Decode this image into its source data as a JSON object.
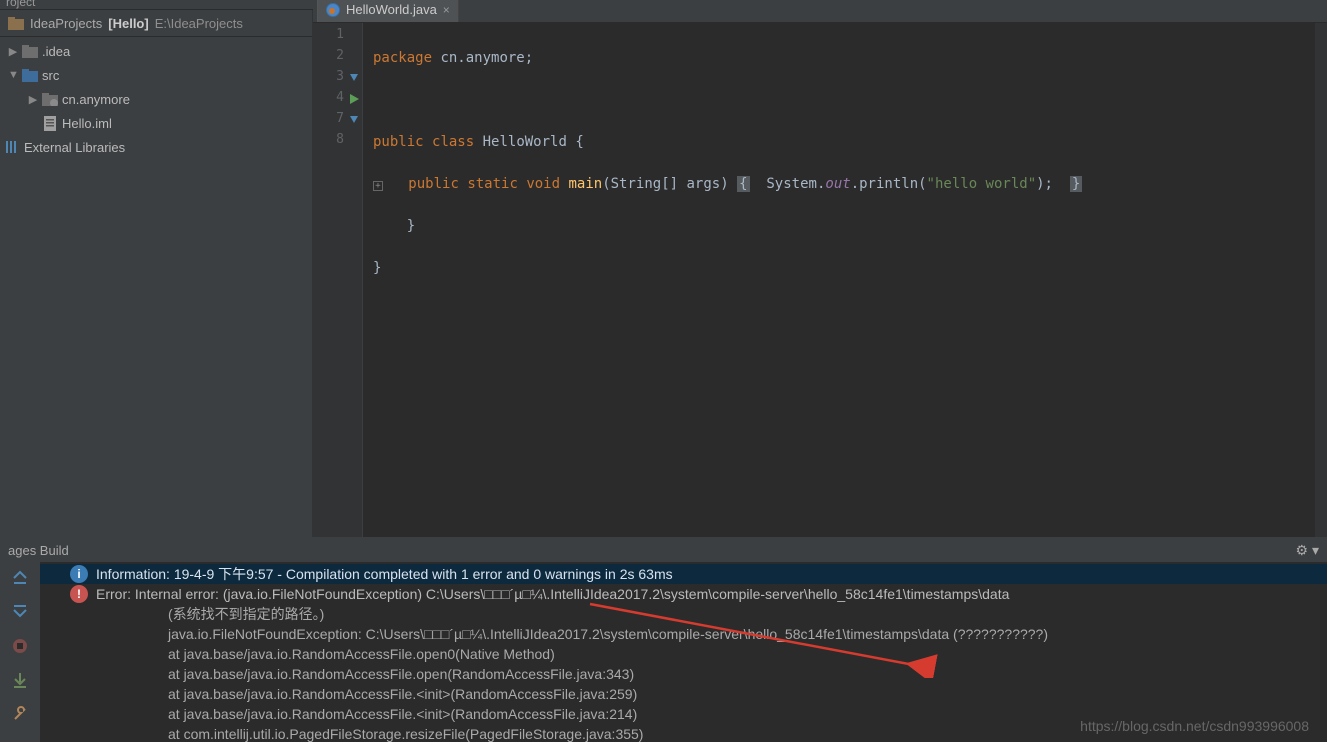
{
  "topbar": {
    "label": "roject"
  },
  "breadcrumb": {
    "project_root": "IdeaProjects",
    "project_name": "[Hello]",
    "project_path": "E:\\IdeaProjects"
  },
  "tree": {
    "idea": ".idea",
    "src": "src",
    "pkg": "cn.anymore",
    "iml": "Hello.iml",
    "ext": "External Libraries"
  },
  "tab": {
    "file": "HelloWorld.java",
    "close": "×"
  },
  "code": {
    "l1_kw": "package",
    "l1_rest": " cn.anymore;",
    "l2": "",
    "l3_kw1": "public",
    "l3_kw2": "class",
    "l3_cls": "HelloWorld",
    "l3_brace": " {",
    "l4_kw1": "public",
    "l4_kw2": "static",
    "l4_kw3": "void",
    "l4_main": "main",
    "l4_params": "(String[] args)",
    "l4_open": "{",
    "l4_sys": "System.",
    "l4_out": "out",
    "l4_call": ".println(",
    "l4_str": "\"hello world\"",
    "l4_end": ");",
    "l4_close": "}",
    "l5": "    }",
    "l6": "}",
    "l7": ""
  },
  "bottom": {
    "header": "ages Build",
    "info": "Information: 19-4-9 下午9:57 - Compilation completed with 1 error and 0 warnings in 2s 63ms",
    "error_line1": "Error: Internal error: (java.io.FileNotFoundException) C:\\Users\\□□□´µ□¼\\.IntelliJIdea2017.2\\system\\compile-server\\hello_58c14fe1\\timestamps\\data",
    "error_line2": "(系统找不到指定的路径。)",
    "trace1": "java.io.FileNotFoundException: C:\\Users\\□□□´µ□¼\\.IntelliJIdea2017.2\\system\\compile-server\\hello_58c14fe1\\timestamps\\data (???????????)",
    "trace2": "at java.base/java.io.RandomAccessFile.open0(Native Method)",
    "trace3": "at java.base/java.io.RandomAccessFile.open(RandomAccessFile.java:343)",
    "trace4": "at java.base/java.io.RandomAccessFile.<init>(RandomAccessFile.java:259)",
    "trace5": "at java.base/java.io.RandomAccessFile.<init>(RandomAccessFile.java:214)",
    "trace6": "at com.intellij.util.io.PagedFileStorage.resizeFile(PagedFileStorage.java:355)"
  },
  "watermark": "https://blog.csdn.net/csdn993996008"
}
